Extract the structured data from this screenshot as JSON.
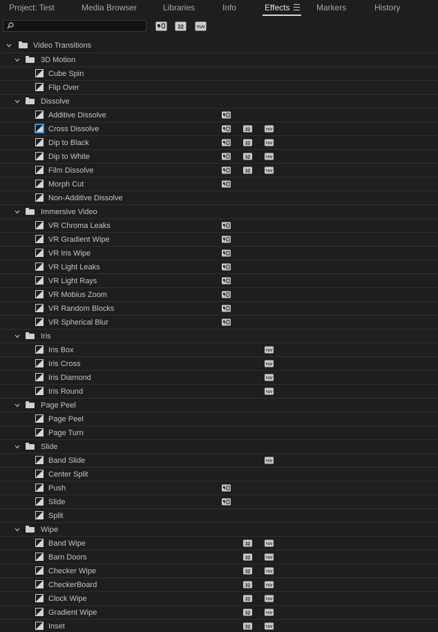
{
  "tabs": [
    {
      "label": "Project: Test",
      "active": false
    },
    {
      "label": "Media Browser",
      "active": false
    },
    {
      "label": "Libraries",
      "active": false
    },
    {
      "label": "Info",
      "active": false
    },
    {
      "label": "Effects",
      "active": true
    },
    {
      "label": "Markers",
      "active": false
    },
    {
      "label": "History",
      "active": false
    }
  ],
  "toolbar": {
    "search_value": "",
    "search_placeholder": "",
    "buttons": [
      {
        "name": "accelerated-effects-filter-button",
        "glyph": "accelerated"
      },
      {
        "name": "32-bit-color-filter-button",
        "glyph": "32"
      },
      {
        "name": "yuv-filter-button",
        "glyph": "YUV"
      }
    ]
  },
  "tree": [
    {
      "type": "folder",
      "level": 0,
      "label": "Video Transitions"
    },
    {
      "type": "folder",
      "level": 1,
      "label": "3D Motion"
    },
    {
      "type": "effect",
      "level": 2,
      "label": "Cube Spin",
      "badges": []
    },
    {
      "type": "effect",
      "level": 2,
      "label": "Flip Over",
      "badges": []
    },
    {
      "type": "folder",
      "level": 1,
      "label": "Dissolve"
    },
    {
      "type": "effect",
      "level": 2,
      "label": "Additive Dissolve",
      "badges": [
        "acc"
      ]
    },
    {
      "type": "effect",
      "level": 2,
      "label": "Cross Dissolve",
      "badges": [
        "acc",
        "32",
        "yuv"
      ],
      "selected": true
    },
    {
      "type": "effect",
      "level": 2,
      "label": "Dip to Black",
      "badges": [
        "acc",
        "32",
        "yuv"
      ]
    },
    {
      "type": "effect",
      "level": 2,
      "label": "Dip to White",
      "badges": [
        "acc",
        "32",
        "yuv"
      ]
    },
    {
      "type": "effect",
      "level": 2,
      "label": "Film Dissolve",
      "badges": [
        "acc",
        "32",
        "yuv"
      ]
    },
    {
      "type": "effect",
      "level": 2,
      "label": "Morph Cut",
      "badges": [
        "acc"
      ]
    },
    {
      "type": "effect",
      "level": 2,
      "label": "Non-Additive Dissolve",
      "badges": []
    },
    {
      "type": "folder",
      "level": 1,
      "label": "Immersive Video"
    },
    {
      "type": "effect",
      "level": 2,
      "label": "VR Chroma Leaks",
      "badges": [
        "acc"
      ]
    },
    {
      "type": "effect",
      "level": 2,
      "label": "VR Gradient Wipe",
      "badges": [
        "acc"
      ]
    },
    {
      "type": "effect",
      "level": 2,
      "label": "VR Iris Wipe",
      "badges": [
        "acc"
      ]
    },
    {
      "type": "effect",
      "level": 2,
      "label": "VR Light Leaks",
      "badges": [
        "acc"
      ]
    },
    {
      "type": "effect",
      "level": 2,
      "label": "VR Light Rays",
      "badges": [
        "acc"
      ]
    },
    {
      "type": "effect",
      "level": 2,
      "label": "VR Mobius Zoom",
      "badges": [
        "acc"
      ]
    },
    {
      "type": "effect",
      "level": 2,
      "label": "VR Random Blocks",
      "badges": [
        "acc"
      ]
    },
    {
      "type": "effect",
      "level": 2,
      "label": "VR Spherical Blur",
      "badges": [
        "acc"
      ]
    },
    {
      "type": "folder",
      "level": 1,
      "label": "Iris"
    },
    {
      "type": "effect",
      "level": 2,
      "label": "Iris Box",
      "badges": [
        "yuv"
      ]
    },
    {
      "type": "effect",
      "level": 2,
      "label": "Iris Cross",
      "badges": [
        "yuv"
      ]
    },
    {
      "type": "effect",
      "level": 2,
      "label": "Iris Diamond",
      "badges": [
        "yuv"
      ]
    },
    {
      "type": "effect",
      "level": 2,
      "label": "Iris Round",
      "badges": [
        "yuv"
      ]
    },
    {
      "type": "folder",
      "level": 1,
      "label": "Page Peel"
    },
    {
      "type": "effect",
      "level": 2,
      "label": "Page Peel",
      "badges": []
    },
    {
      "type": "effect",
      "level": 2,
      "label": "Page Turn",
      "badges": []
    },
    {
      "type": "folder",
      "level": 1,
      "label": "Slide"
    },
    {
      "type": "effect",
      "level": 2,
      "label": "Band Slide",
      "badges": [
        "yuv"
      ]
    },
    {
      "type": "effect",
      "level": 2,
      "label": "Center Split",
      "badges": []
    },
    {
      "type": "effect",
      "level": 2,
      "label": "Push",
      "badges": [
        "acc"
      ]
    },
    {
      "type": "effect",
      "level": 2,
      "label": "Slide",
      "badges": [
        "acc"
      ]
    },
    {
      "type": "effect",
      "level": 2,
      "label": "Split",
      "badges": []
    },
    {
      "type": "folder",
      "level": 1,
      "label": "Wipe"
    },
    {
      "type": "effect",
      "level": 2,
      "label": "Band Wipe",
      "badges": [
        "32",
        "yuv"
      ]
    },
    {
      "type": "effect",
      "level": 2,
      "label": "Barn Doors",
      "badges": [
        "32",
        "yuv"
      ]
    },
    {
      "type": "effect",
      "level": 2,
      "label": "Checker Wipe",
      "badges": [
        "32",
        "yuv"
      ]
    },
    {
      "type": "effect",
      "level": 2,
      "label": "CheckerBoard",
      "badges": [
        "32",
        "yuv"
      ]
    },
    {
      "type": "effect",
      "level": 2,
      "label": "Clock Wipe",
      "badges": [
        "32",
        "yuv"
      ]
    },
    {
      "type": "effect",
      "level": 2,
      "label": "Gradient Wipe",
      "badges": [
        "32",
        "yuv"
      ]
    },
    {
      "type": "effect",
      "level": 2,
      "label": "Inset",
      "badges": [
        "32",
        "yuv"
      ]
    }
  ],
  "colors": {
    "background": "#1e1e1e",
    "row_divider": "#2f2f2f",
    "text": "#c4c4c4",
    "selection_outline": "#4a8fe0"
  }
}
